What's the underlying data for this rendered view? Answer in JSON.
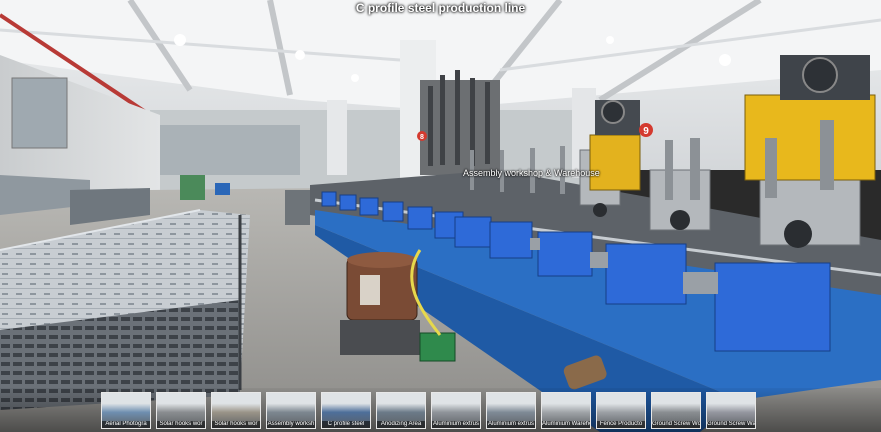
{
  "scene": {
    "title": "C profile steel production line",
    "hotspot_label": "Assembly workshop & Warehouse",
    "machine_badge_left": "8",
    "machine_badge_right": "9"
  },
  "thumbnails": [
    {
      "label": "Aerial Photogra",
      "color": "#6f8fb0"
    },
    {
      "label": "Solar hooks wor",
      "color": "#8a8d90"
    },
    {
      "label": "Solar hooks wor",
      "color": "#9a9488"
    },
    {
      "label": "Assembly worksh",
      "color": "#7d8790"
    },
    {
      "label": "C profile steel",
      "color": "#4e6f9a"
    },
    {
      "label": "Anodizing Area",
      "color": "#6b7a88"
    },
    {
      "label": "Aluminium extrus",
      "color": "#8f949a"
    },
    {
      "label": "Aluminium extrus",
      "color": "#7f8a96"
    },
    {
      "label": "Aluminium Warehe",
      "color": "#a0a4a8"
    },
    {
      "label": "Fence Producto",
      "color": "#9ca0a5"
    },
    {
      "label": "Ground Screw Wo",
      "color": "#8a8e92"
    },
    {
      "label": "Ground Screw Wa",
      "color": "#9597a0"
    }
  ]
}
